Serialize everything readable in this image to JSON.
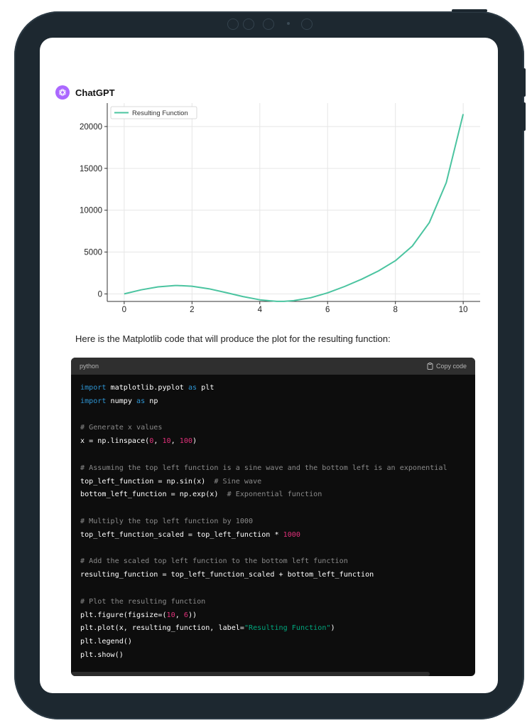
{
  "chat": {
    "sender": "ChatGPT",
    "message": "Here is the Matplotlib code that will produce the plot for the resulting function:"
  },
  "chart_data": {
    "type": "line",
    "title": "",
    "xlabel": "",
    "ylabel": "",
    "xlim": [
      -0.5,
      10.5
    ],
    "ylim": [
      -900,
      22800
    ],
    "xticks": [
      0,
      2,
      4,
      6,
      8,
      10
    ],
    "yticks": [
      0,
      5000,
      10000,
      15000,
      20000
    ],
    "grid": true,
    "legend_position": "top-left",
    "series": [
      {
        "name": "Resulting Function",
        "color": "#4bc4a0",
        "x": [
          0,
          0.5,
          1,
          1.5,
          1.57,
          2,
          2.5,
          3,
          3.5,
          4,
          4.5,
          4.71,
          5,
          5.5,
          6,
          6.5,
          7,
          7.5,
          8,
          8.5,
          9,
          9.5,
          10
        ],
        "y": [
          1,
          481,
          844,
          1002,
          1005,
          917,
          611,
          161,
          -317,
          -702,
          -888,
          -889,
          -810,
          -461,
          124,
          881,
          1754,
          2746,
          3970,
          5717,
          8515,
          13296,
          21482
        ]
      }
    ]
  },
  "code": {
    "language": "python",
    "copy_label": "Copy code",
    "lines": [
      [
        {
          "t": "kw",
          "v": "import"
        },
        {
          "t": "",
          "v": " matplotlib.pyplot "
        },
        {
          "t": "kw",
          "v": "as"
        },
        {
          "t": "",
          "v": " plt"
        }
      ],
      [
        {
          "t": "kw",
          "v": "import"
        },
        {
          "t": "",
          "v": " numpy "
        },
        {
          "t": "kw",
          "v": "as"
        },
        {
          "t": "",
          "v": " np"
        }
      ],
      [],
      [
        {
          "t": "cm",
          "v": "# Generate x values"
        }
      ],
      [
        {
          "t": "",
          "v": "x = np.linspace("
        },
        {
          "t": "num",
          "v": "0"
        },
        {
          "t": "",
          "v": ", "
        },
        {
          "t": "num",
          "v": "10"
        },
        {
          "t": "",
          "v": ", "
        },
        {
          "t": "num",
          "v": "100"
        },
        {
          "t": "",
          "v": ")"
        }
      ],
      [],
      [
        {
          "t": "cm",
          "v": "# Assuming the top left function is a sine wave and the bottom left is an exponential"
        }
      ],
      [
        {
          "t": "",
          "v": "top_left_function = np.sin(x)  "
        },
        {
          "t": "cm",
          "v": "# Sine wave"
        }
      ],
      [
        {
          "t": "",
          "v": "bottom_left_function = np.exp(x)  "
        },
        {
          "t": "cm",
          "v": "# Exponential function"
        }
      ],
      [],
      [
        {
          "t": "cm",
          "v": "# Multiply the top left function by 1000"
        }
      ],
      [
        {
          "t": "",
          "v": "top_left_function_scaled = top_left_function * "
        },
        {
          "t": "num",
          "v": "1000"
        }
      ],
      [],
      [
        {
          "t": "cm",
          "v": "# Add the scaled top left function to the bottom left function"
        }
      ],
      [
        {
          "t": "",
          "v": "resulting_function = top_left_function_scaled + bottom_left_function"
        }
      ],
      [],
      [
        {
          "t": "cm",
          "v": "# Plot the resulting function"
        }
      ],
      [
        {
          "t": "",
          "v": "plt.figure(figsize=("
        },
        {
          "t": "num",
          "v": "10"
        },
        {
          "t": "",
          "v": ", "
        },
        {
          "t": "num",
          "v": "6"
        },
        {
          "t": "",
          "v": "))"
        }
      ],
      [
        {
          "t": "",
          "v": "plt.plot(x, resulting_function, label="
        },
        {
          "t": "st",
          "v": "\"Resulting Function\""
        },
        {
          "t": "",
          "v": ")"
        }
      ],
      [
        {
          "t": "",
          "v": "plt.legend()"
        }
      ],
      [
        {
          "t": "",
          "v": "plt.show()"
        }
      ]
    ]
  }
}
